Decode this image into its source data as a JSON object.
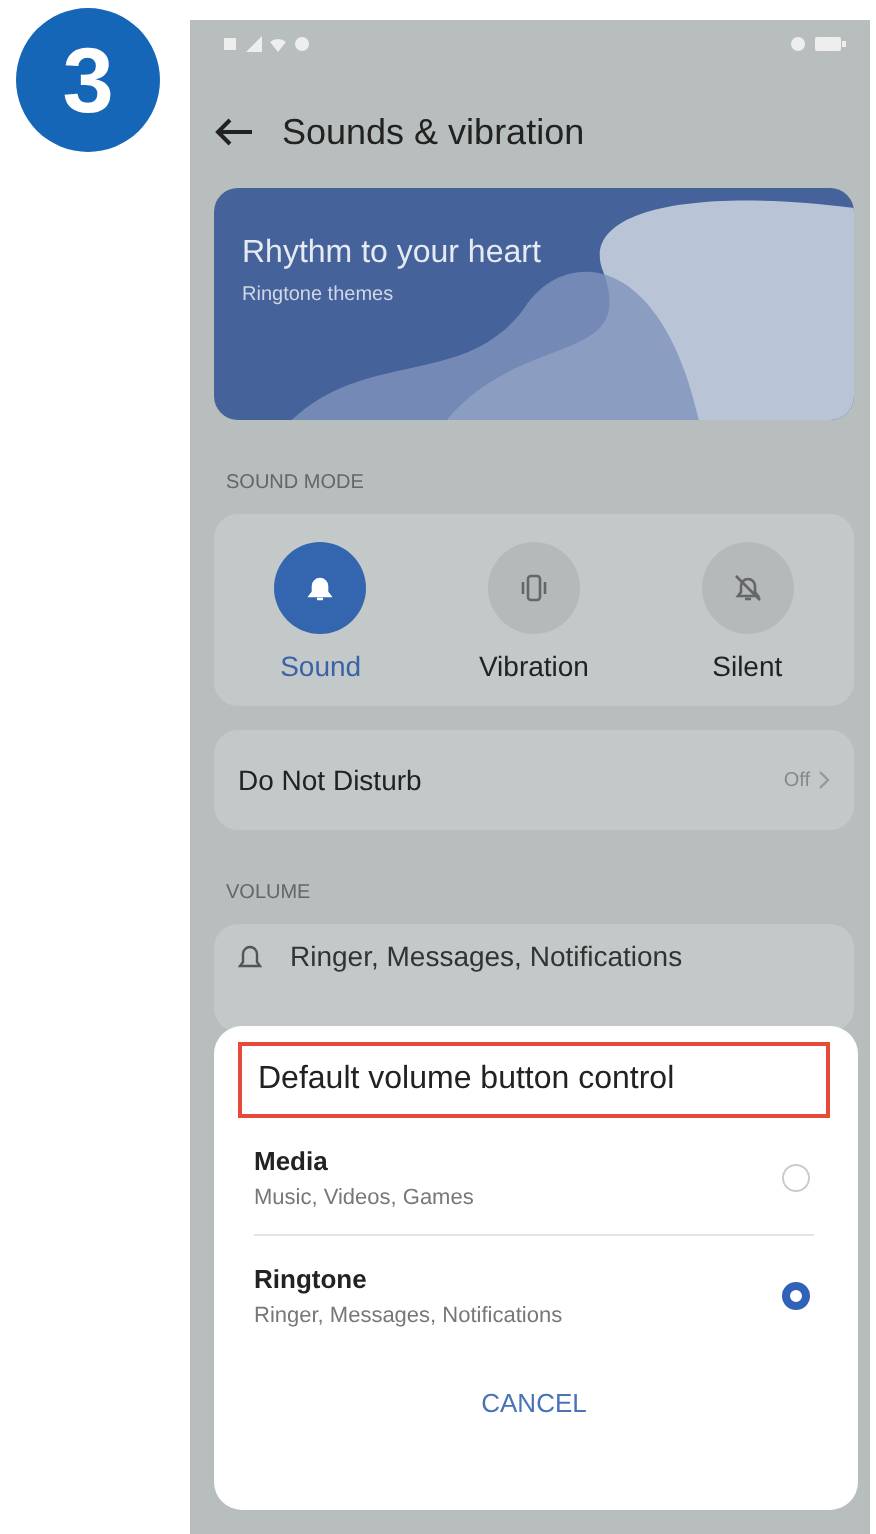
{
  "step": {
    "number": "3"
  },
  "header": {
    "title": "Sounds & vibration"
  },
  "banner": {
    "title": "Rhythm to your heart",
    "subtitle": "Ringtone themes"
  },
  "sound_mode": {
    "label": "SOUND MODE",
    "modes": [
      {
        "kind": "sound",
        "label": "Sound",
        "selected": true
      },
      {
        "kind": "vibration",
        "label": "Vibration",
        "selected": false
      },
      {
        "kind": "silent",
        "label": "Silent",
        "selected": false
      }
    ]
  },
  "do_not_disturb": {
    "label": "Do Not Disturb",
    "value": "Off"
  },
  "volume": {
    "label": "VOLUME",
    "rows": [
      "Ringer, Messages, Notifications"
    ]
  },
  "dialog": {
    "title": "Default volume button control",
    "highlighted": true,
    "options": [
      {
        "title": "Media",
        "subtitle": "Music, Videos, Games",
        "selected": false
      },
      {
        "title": "Ringtone",
        "subtitle": "Ringer, Messages, Notifications",
        "selected": true
      }
    ],
    "cancel": "CANCEL"
  }
}
